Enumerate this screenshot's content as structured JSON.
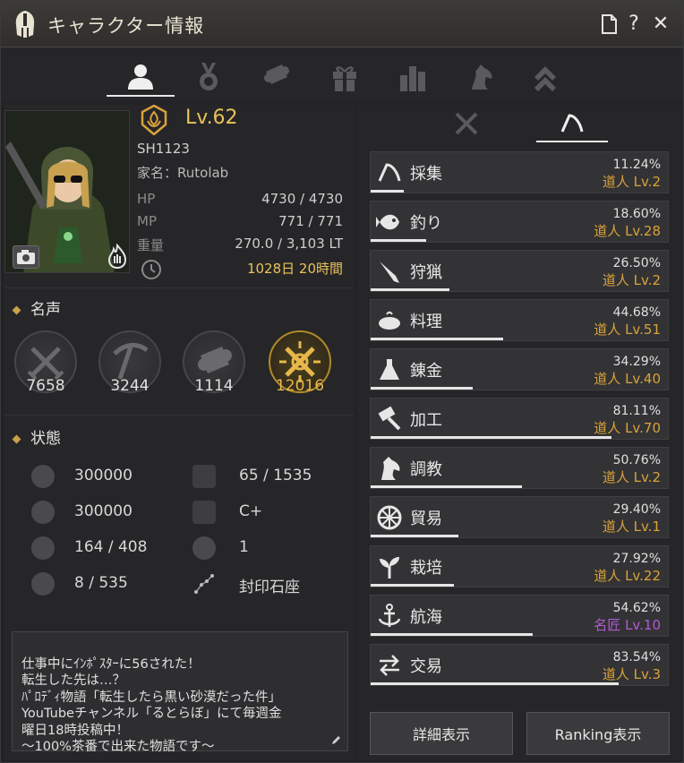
{
  "window": {
    "title": "キャラクター情報",
    "buttons": {
      "help": "?",
      "close": "✕"
    }
  },
  "top_nav": {
    "tabs": [
      {
        "name": "character",
        "icon": "person-icon",
        "active": true
      },
      {
        "name": "medal",
        "icon": "medal-icon",
        "active": false
      },
      {
        "name": "scroll",
        "icon": "scroll-icon",
        "active": false
      },
      {
        "name": "gift",
        "icon": "gift-icon",
        "active": false
      },
      {
        "name": "stats",
        "icon": "bar-chart-icon",
        "active": false
      },
      {
        "name": "horse",
        "icon": "horse-icon",
        "active": false
      },
      {
        "name": "rank",
        "icon": "chevron-up-icon",
        "active": false
      }
    ]
  },
  "character": {
    "level": "Lv.62",
    "name": "SH1123",
    "family": "家名：Rutolab",
    "hp_label": "HP",
    "hp": "4730 / 4730",
    "mp_label": "MP",
    "mp": "771 / 771",
    "weight_label": "重量",
    "weight": "270.0 / 3,103 LT",
    "playtime": "1028日 20時間"
  },
  "fame": {
    "title": "名声",
    "items": [
      {
        "icon": "swords-icon",
        "value": "7658",
        "gold": false
      },
      {
        "icon": "pickaxe-icon",
        "value": "3244",
        "gold": false
      },
      {
        "icon": "scroll-icon",
        "value": "1114",
        "gold": false
      },
      {
        "icon": "crossed-swords-gold-icon",
        "value": "12016",
        "gold": true
      }
    ]
  },
  "status": {
    "title": "状態",
    "left": [
      {
        "icon": "skull-icon",
        "value": "300000"
      },
      {
        "icon": "officer-icon",
        "value": "300000"
      },
      {
        "icon": "strength-icon",
        "value": "164 / 408"
      },
      {
        "icon": "taurus-icon",
        "value": "8 / 535"
      }
    ],
    "right": [
      {
        "icon": "axe-icon",
        "value": "65 / 1535"
      },
      {
        "icon": "music-icon",
        "value": "C+"
      },
      {
        "icon": "flame-icon",
        "value": "1"
      },
      {
        "icon": "constellation-icon",
        "value": "封印石座"
      }
    ]
  },
  "bio": "仕事中にｲﾝﾎﾟｽﾀｰに56された！\n転生した先は…？\nﾊﾟﾛﾃﾞｨ物語「転生したら黒い砂漠だった件」\nYouTubeチャンネル「るとらぼ」にて毎週金\n曜日18時投稿中！\n〜100%茶番で出来た物語です〜",
  "life_skills": [
    {
      "icon": "sickle-icon",
      "name": "採集",
      "pct": "11.24%",
      "level": "道人 Lv.2",
      "purple": false,
      "progress": 0.1124
    },
    {
      "icon": "fish-icon",
      "name": "釣り",
      "pct": "18.60%",
      "level": "道人 Lv.28",
      "purple": false,
      "progress": 0.186
    },
    {
      "icon": "musket-icon",
      "name": "狩猟",
      "pct": "26.50%",
      "level": "道人 Lv.2",
      "purple": false,
      "progress": 0.265
    },
    {
      "icon": "cooking-icon",
      "name": "料理",
      "pct": "44.68%",
      "level": "道人 Lv.51",
      "purple": false,
      "progress": 0.4468
    },
    {
      "icon": "flask-icon",
      "name": "錬金",
      "pct": "34.29%",
      "level": "道人 Lv.40",
      "purple": false,
      "progress": 0.3429
    },
    {
      "icon": "hammer-icon",
      "name": "加工",
      "pct": "81.11%",
      "level": "道人 Lv.70",
      "purple": false,
      "progress": 0.8111
    },
    {
      "icon": "horse-head-icon",
      "name": "調教",
      "pct": "50.76%",
      "level": "道人 Lv.2",
      "purple": false,
      "progress": 0.5076
    },
    {
      "icon": "wheel-icon",
      "name": "貿易",
      "pct": "29.40%",
      "level": "道人 Lv.1",
      "purple": false,
      "progress": 0.294
    },
    {
      "icon": "sprout-icon",
      "name": "栽培",
      "pct": "27.92%",
      "level": "道人 Lv.22",
      "purple": false,
      "progress": 0.2792
    },
    {
      "icon": "anchor-icon",
      "name": "航海",
      "pct": "54.62%",
      "level": "名匠 Lv.10",
      "purple": true,
      "progress": 0.5462
    },
    {
      "icon": "exchange-icon",
      "name": "交易",
      "pct": "83.54%",
      "level": "道人 Lv.3",
      "purple": false,
      "progress": 0.8354
    }
  ],
  "buttons": {
    "details": "詳細表示",
    "ranking": "Ranking表示"
  },
  "colors": {
    "gold": "#e8c25a",
    "level_orange": "#d9a23a",
    "master_purple": "#b35ad6"
  }
}
